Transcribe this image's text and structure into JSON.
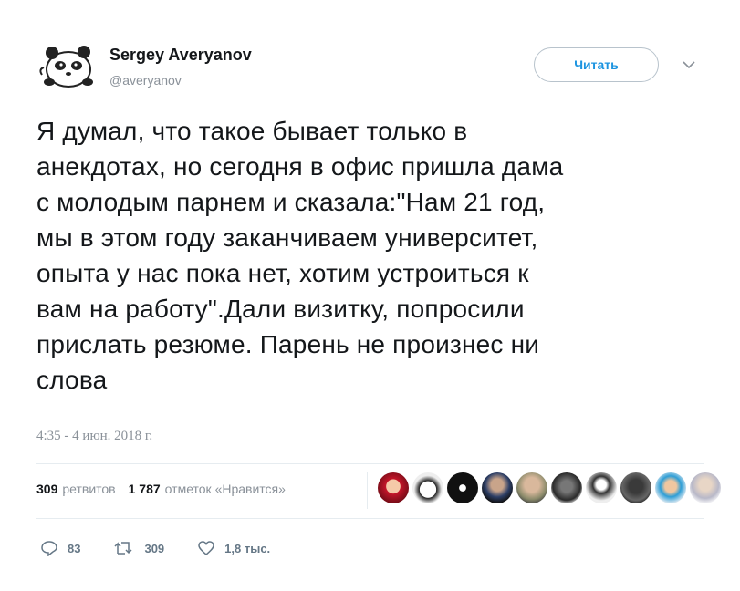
{
  "user": {
    "display_name": "Sergey Averyanov",
    "handle": "@averyanov",
    "avatar_icon": "panda-icon"
  },
  "follow_button": {
    "label": "Читать"
  },
  "menu_icon": "chevron-down-icon",
  "tweet": {
    "text": "Я думал, что такое бывает только в\nанекдотах, но сегодня в офис пришла дама\nс молодым парнем и сказала:\"Нам 21 год,\nмы в этом году заканчиваем университет,\nопыта у нас пока нет, хотим устроиться к\nвам на работу\".Дали визитку, попросили\nприслать резюме. Парень не произнес ни\nслова",
    "timestamp": "4:35 - 4 июн. 2018 г."
  },
  "stats": {
    "retweets_count": "309",
    "retweets_label": "ретвитов",
    "likes_count": "1 787",
    "likes_label": "отметок «Нравится»"
  },
  "actions": {
    "reply_count": "83",
    "retweet_count": "309",
    "like_count": "1,8 тыс."
  },
  "colors": {
    "accent": "#1c94e0",
    "muted": "#8a9199",
    "text": "#14171a"
  }
}
